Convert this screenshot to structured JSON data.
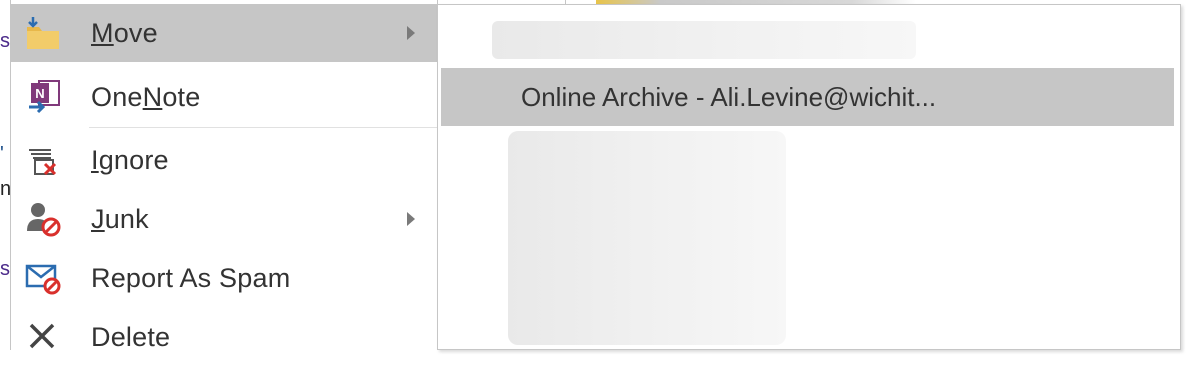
{
  "menu": {
    "items": [
      {
        "name": "move",
        "pre": "",
        "u": "M",
        "post": "ove",
        "has_submenu": true,
        "active": true,
        "icon": "folder-move-icon"
      },
      {
        "name": "onenote",
        "pre": "One",
        "u": "N",
        "post": "ote",
        "has_submenu": false,
        "active": false,
        "icon": "onenote-icon"
      },
      {
        "name": "ignore",
        "pre": "",
        "u": "I",
        "post": "gnore",
        "has_submenu": false,
        "active": false,
        "icon": "ignore-icon"
      },
      {
        "name": "junk",
        "pre": "",
        "u": "J",
        "post": "unk",
        "has_submenu": true,
        "active": false,
        "icon": "junk-icon"
      },
      {
        "name": "report-as-spam",
        "pre": "Report As Spam",
        "u": "",
        "post": "",
        "has_submenu": false,
        "active": false,
        "icon": "report-spam-icon"
      },
      {
        "name": "delete",
        "pre": "Delete",
        "u": "",
        "post": "",
        "has_submenu": false,
        "active": false,
        "icon": "delete-icon"
      }
    ]
  },
  "submenu": {
    "items": [
      {
        "label": "Online Archive - Ali.Levine@wichit...",
        "active": true
      }
    ]
  },
  "colors": {
    "highlight": "#c6c6c6",
    "text": "#333333",
    "onenote_purple": "#80397b",
    "folder_yellow": "#e8b84a",
    "spam_red": "#d9302c",
    "outlook_blue": "#2b6cb0"
  }
}
